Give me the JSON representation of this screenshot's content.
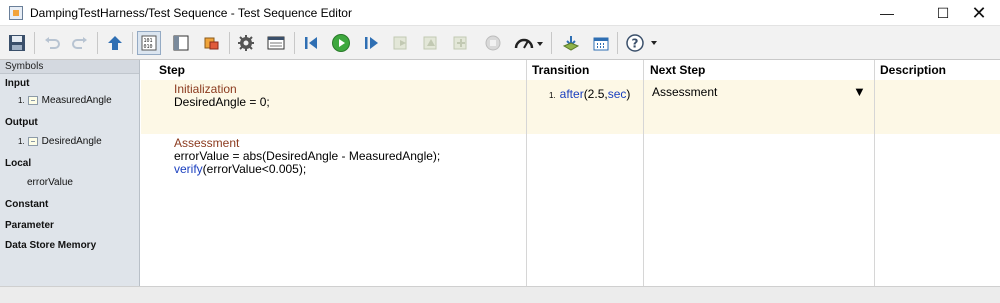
{
  "window": {
    "title": "DampingTestHarness/Test Sequence - Test Sequence Editor",
    "minimize_glyph": "—",
    "maximize_glyph": "☐",
    "close_glyph": "✕"
  },
  "toolbar": {
    "icons": [
      "save-icon",
      "undo-icon",
      "redo-icon",
      "up-icon",
      "symbols-pane-icon",
      "property-pane-icon",
      "data-icon",
      "settings-icon",
      "model-explorer-icon",
      "step-back-icon",
      "run-icon",
      "step-forward-icon",
      "stop-icon",
      "sim-pace-icon",
      "logging-icon",
      "calendar-icon",
      "help-icon"
    ],
    "accent_green": "#3ea83e",
    "accent_blue": "#2f6fb3"
  },
  "symbols": {
    "header": "Symbols",
    "categories": {
      "input": "Input",
      "output": "Output",
      "local": "Local",
      "constant": "Constant",
      "parameter": "Parameter",
      "data_store_memory": "Data Store Memory"
    },
    "input_items": [
      {
        "num": "1.",
        "name": "MeasuredAngle"
      }
    ],
    "output_items": [
      {
        "num": "1.",
        "name": "DesiredAngle"
      }
    ],
    "local_items": [
      "errorValue"
    ]
  },
  "table": {
    "headers": {
      "step": "Step",
      "transition": "Transition",
      "next_step": "Next Step",
      "description": "Description"
    },
    "rows": [
      {
        "step_name": "Initialization",
        "code_line1": "DesiredAngle = 0;",
        "transition": {
          "num": "1.",
          "func": "after",
          "open": "(2.5,",
          "unit": "sec",
          "close": ")"
        },
        "next_step": "Assessment",
        "dropdown_glyph": "▼"
      },
      {
        "step_name": "Assessment",
        "code_line1": "errorValue = abs(DesiredAngle - MeasuredAngle);",
        "code_line2_kw": "verify",
        "code_line2_rest": "(errorValue<0.005);"
      }
    ],
    "row_highlight_color": "#fdf8e6",
    "step_name_color": "#8b3a1e",
    "keyword_color": "#1a3fbf"
  }
}
